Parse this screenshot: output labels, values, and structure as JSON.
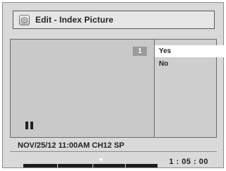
{
  "header": {
    "title": "Edit - Index Picture",
    "icon": "disc-icon"
  },
  "picture": {
    "index_number": "1",
    "playback_state_icon": "pause-icon"
  },
  "options": [
    {
      "label": "Yes",
      "selected": true
    },
    {
      "label": "No",
      "selected": false
    }
  ],
  "info": {
    "recording_info": "NOV/25/12 11:00AM CH12 SP"
  },
  "progress": {
    "position_fraction": 0.58,
    "time": "1 : 05 : 00"
  },
  "colors": {
    "background": "#d9d9d9",
    "selected_option": "#ffffff",
    "progress_bar": "#1c1c1c"
  }
}
